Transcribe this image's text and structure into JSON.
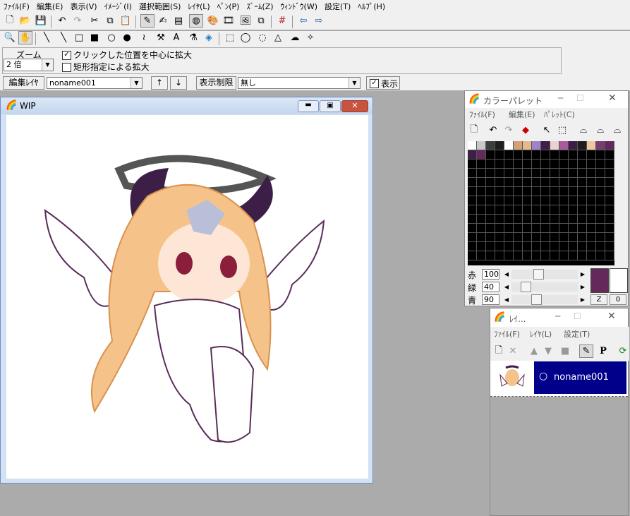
{
  "menu": [
    "ﾌｧｲﾙ(F)",
    "編集(E)",
    "表示(V)",
    "ｲﾒｰｼﾞ(I)",
    "選択範囲(S)",
    "ﾚｲﾔ(L)",
    "ﾍﾟﾝ(P)",
    "ｽﾞｰﾑ(Z)",
    "ｳｨﾝﾄﾞｳ(W)",
    "設定(T)",
    "ﾍﾙﾌﾟ(H)"
  ],
  "zoom": {
    "label": "ズーム",
    "value": "2 倍",
    "option_center": "クリックした位置を中心に拡大",
    "option_center_checked": "✓",
    "option_rect": "矩形指定による拡大"
  },
  "layerbar": {
    "edit_label": "編集ﾚｲﾔ",
    "edit_value": "noname001",
    "up": "↑",
    "down": "↓",
    "limit_label": "表示制限",
    "limit_value": "無し",
    "show_check": "✓",
    "show_label": "表示"
  },
  "canvas_window": {
    "title": "WIP"
  },
  "palette": {
    "title": "カラーパレット",
    "menu": [
      "ﾌｧｲﾙ(F)",
      "編集(E)",
      "ﾊﾟﾚｯﾄ(C)"
    ],
    "sliders": [
      {
        "label": "赤",
        "value": "100",
        "fraction": 0.39
      },
      {
        "label": "緑",
        "value": "40",
        "fraction": 0.16
      },
      {
        "label": "青",
        "value": "90",
        "fraction": 0.35
      }
    ],
    "current_color": "#64285a",
    "z_label": "Z",
    "zero_label": "0",
    "swatches": [
      "#ffffff",
      "#c8c8c8",
      "#3c3c3c",
      "#1e1e1e",
      "#ffffff",
      "#d2a07a",
      "#e6b98c",
      "#a082c8",
      "#3c1e46",
      "#ebd2d2",
      "#aa5a9b",
      "#3c1e46",
      "#1e1e1e",
      "#f0c8a0",
      "#783c6e",
      "#64285a",
      "#3c1e46",
      "#64285a"
    ]
  },
  "layer_window": {
    "title": "ﾚｲ...",
    "menu": [
      "ﾌｧｲﾙ(F)",
      "ﾚｲﾔ(L)",
      "設定(T)"
    ],
    "layer_name": "noname001",
    "visibility_icon": "○",
    "p_label": "P"
  },
  "colors": {
    "selection_blue": "#00008b",
    "accent_purple": "#64285a"
  }
}
